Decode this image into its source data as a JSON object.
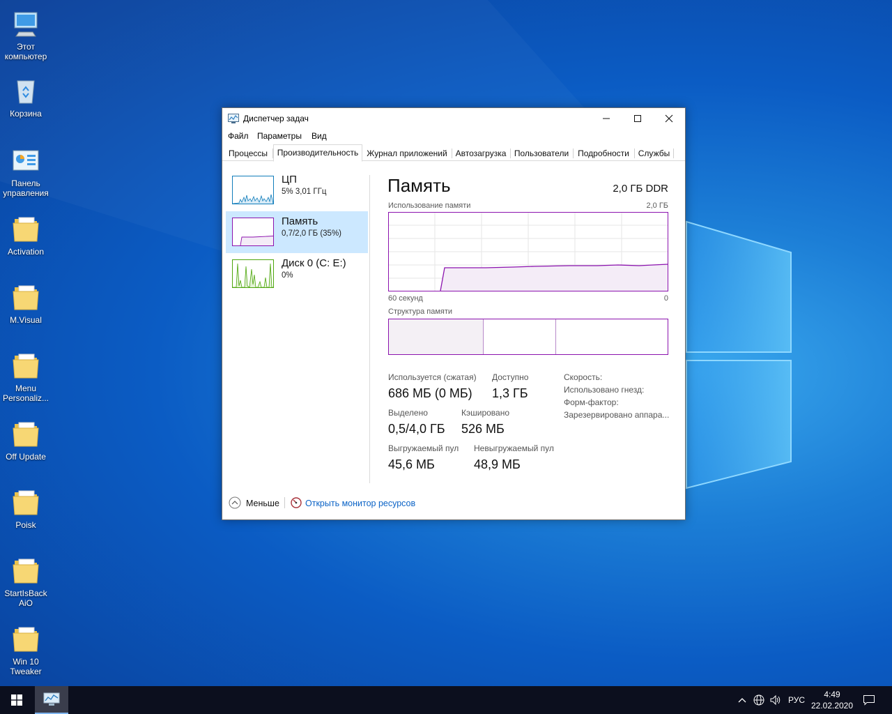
{
  "desktop": {
    "icons": [
      {
        "label_1": "Этот",
        "label_2": "компьютер",
        "icon": "computer-icon"
      },
      {
        "label_1": "Корзина",
        "label_2": "",
        "icon": "recycle-bin-icon"
      },
      {
        "label_1": "Панель",
        "label_2": "управления",
        "icon": "control-panel-icon"
      },
      {
        "label_1": "Activation",
        "label_2": "",
        "icon": "folder-icon"
      },
      {
        "label_1": "M.Visual",
        "label_2": "",
        "icon": "folder-icon"
      },
      {
        "label_1": "Menu",
        "label_2": "Personaliz...",
        "icon": "folder-icon"
      },
      {
        "label_1": "Off Update",
        "label_2": "",
        "icon": "folder-icon"
      },
      {
        "label_1": "Poisk",
        "label_2": "",
        "icon": "folder-icon"
      },
      {
        "label_1": "StartIsBack",
        "label_2": "AiO",
        "icon": "folder-icon"
      },
      {
        "label_1": "Win 10",
        "label_2": "Tweaker",
        "icon": "folder-icon"
      }
    ]
  },
  "window": {
    "title": "Диспетчер задач",
    "menu": [
      "Файл",
      "Параметры",
      "Вид"
    ],
    "tabs": [
      "Процессы",
      "Производительность",
      "Журнал приложений",
      "Автозагрузка",
      "Пользователи",
      "Подробности",
      "Службы"
    ],
    "active_tab": "Производительность"
  },
  "sidebar": {
    "items": [
      {
        "title": "ЦП",
        "subtitle": "5%  3,01 ГГц",
        "selected": false,
        "color": "#117dbb"
      },
      {
        "title": "Память",
        "subtitle": "0,7/2,0 ГБ (35%)",
        "selected": true,
        "color": "#8b12ae"
      },
      {
        "title": "Диск 0 (C: E:)",
        "subtitle": "0%",
        "selected": false,
        "color": "#4da60c"
      }
    ]
  },
  "memory": {
    "heading": "Память",
    "type": "2,0 ГБ DDR",
    "usage_label": "Использование памяти",
    "usage_max": "2,0 ГБ",
    "time_left": "60 секунд",
    "time_right": "0",
    "structure_label": "Структура памяти",
    "stats": {
      "in_use_label": "Используется (сжатая)",
      "in_use_value": "686 МБ (0 МБ)",
      "available_label": "Доступно",
      "available_value": "1,3 ГБ",
      "committed_label": "Выделено",
      "committed_value": "0,5/4,0 ГБ",
      "cached_label": "Кэшировано",
      "cached_value": "526 МБ",
      "paged_label": "Выгружаемый пул",
      "paged_value": "45,6 МБ",
      "nonpaged_label": "Невыгружаемый пул",
      "nonpaged_value": "48,9 МБ"
    },
    "info": {
      "speed": "Скорость:",
      "slots": "Использовано гнезд:",
      "form_factor": "Форм-фактор:",
      "reserved": "Зарезервировано аппара..."
    },
    "accent_color": "#8b12ae"
  },
  "footer": {
    "less_label": "Меньше",
    "monitor_label": "Открыть монитор ресурсов"
  },
  "taskbar": {
    "language": "РУС",
    "time": "4:49",
    "date": "22.02.2020"
  }
}
